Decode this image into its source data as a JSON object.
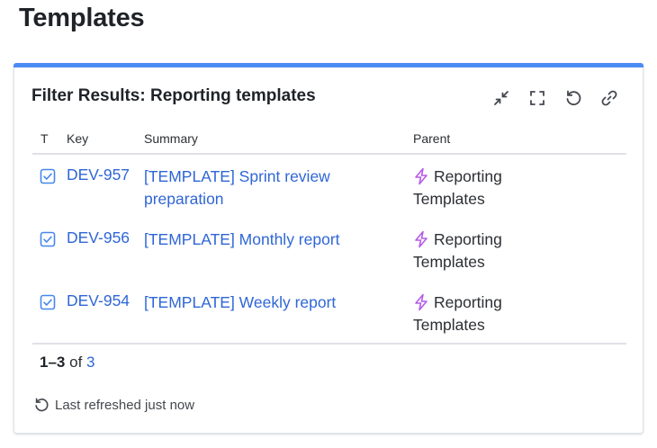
{
  "page": {
    "title": "Templates"
  },
  "card": {
    "title": "Filter Results: Reporting templates",
    "accent_color": "#4c8bf5",
    "actions": [
      "collapse-icon",
      "fullscreen-icon",
      "refresh-icon",
      "link-icon"
    ]
  },
  "table": {
    "headers": {
      "type": "T",
      "key": "Key",
      "summary": "Summary",
      "parent": "Parent"
    },
    "rows": [
      {
        "key": "DEV-957",
        "summary": "[TEMPLATE] Sprint review preparation",
        "parent": "Reporting Templates"
      },
      {
        "key": "DEV-956",
        "summary": "[TEMPLATE] Monthly report",
        "parent": "Reporting Templates"
      },
      {
        "key": "DEV-954",
        "summary": "[TEMPLATE] Weekly report",
        "parent": "Reporting Templates"
      }
    ]
  },
  "pagination": {
    "range": "1–3",
    "of": "of",
    "total": "3"
  },
  "footer": {
    "refreshed": "Last refreshed just now"
  },
  "colors": {
    "link": "#2f66d6",
    "epic": "#b65be8",
    "task": "#4688ec"
  }
}
